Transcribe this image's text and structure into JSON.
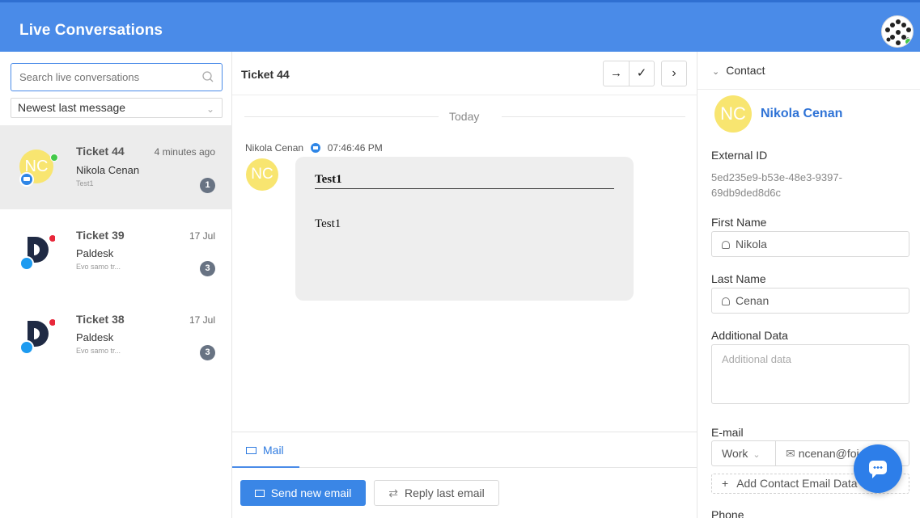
{
  "app": {
    "title": "Live Conversations"
  },
  "search": {
    "placeholder": "Search live conversations"
  },
  "sort": {
    "value": "Newest last message"
  },
  "conversations": [
    {
      "title": "Ticket 44",
      "time": "4 minutes ago",
      "name": "Nikola Cenan",
      "snippet": "Test1",
      "count": "1",
      "avatar": "NC",
      "channel": "chat-icon",
      "active": true
    },
    {
      "title": "Ticket 39",
      "time": "17 Jul",
      "name": "Paldesk",
      "snippet": "Evo samo tr...",
      "count": "3",
      "channel": "twitter-icon"
    },
    {
      "title": "Ticket 38",
      "time": "17 Jul",
      "name": "Paldesk",
      "snippet": "Evo samo tr...",
      "count": "3",
      "channel": "twitter-icon"
    }
  ],
  "ticket": {
    "title": "Ticket 44",
    "actions": [
      "arrow-right-icon",
      "check-icon",
      "chevron-right-icon"
    ],
    "day_label": "Today",
    "message": {
      "author": "Nikola Cenan",
      "time": "07:46:46 PM",
      "avatar": "NC",
      "heading": "Test1",
      "body": "Test1"
    },
    "tab_mail": "Mail",
    "send_label": "Send new email",
    "reply_label": "Reply last email"
  },
  "contact": {
    "section_label": "Contact",
    "avatar": "NC",
    "name": "Nikola Cenan",
    "external_id_label": "External ID",
    "external_id": "5ed235e9-b53e-48e3-9397-69db9ded8d6c",
    "first_name_label": "First Name",
    "first_name": "Nikola",
    "last_name_label": "Last Name",
    "last_name": "Cenan",
    "additional_label": "Additional Data",
    "additional_placeholder": "Additional data",
    "email_label": "E-mail",
    "email_type": "Work",
    "email_value": "ncenan@foj",
    "add_email_label": "Add Contact Email Data",
    "phone_label": "Phone"
  },
  "colors": {
    "header": "#4a8be8",
    "accent": "#2f7be0",
    "avatar_yellow": "#f8e570",
    "online": "#43c94a"
  }
}
